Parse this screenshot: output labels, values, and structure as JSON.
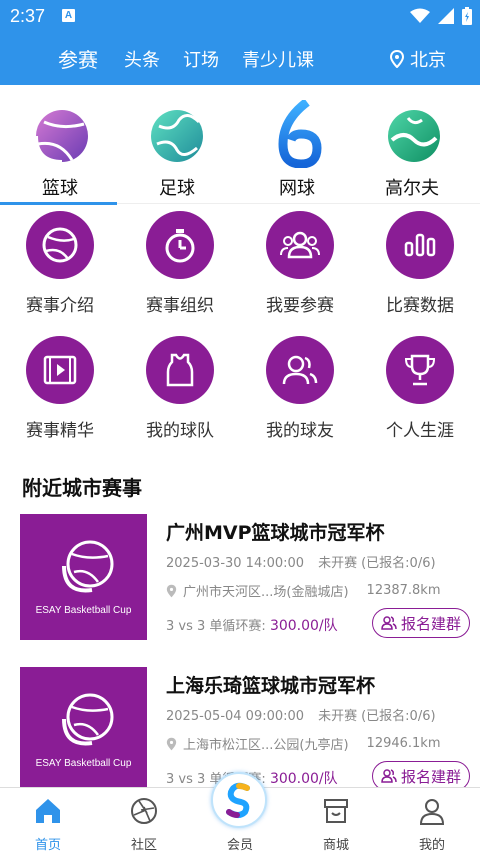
{
  "status": {
    "time": "2:37",
    "a_icon": "A"
  },
  "nav": {
    "tabs": [
      "参赛",
      "头条",
      "订场",
      "青少儿课"
    ],
    "location": "北京"
  },
  "sports": [
    "篮球",
    "足球",
    "网球",
    "高尔夫"
  ],
  "functions": [
    {
      "label": "赛事介绍",
      "icon": "basketball-icon"
    },
    {
      "label": "赛事组织",
      "icon": "stopwatch-icon"
    },
    {
      "label": "我要参赛",
      "icon": "group-icon"
    },
    {
      "label": "比赛数据",
      "icon": "bar-chart-icon"
    },
    {
      "label": "赛事精华",
      "icon": "video-icon"
    },
    {
      "label": "我的球队",
      "icon": "jersey-icon"
    },
    {
      "label": "我的球友",
      "icon": "friends-icon"
    },
    {
      "label": "个人生涯",
      "icon": "trophy-icon"
    }
  ],
  "section": {
    "title": "附近城市赛事"
  },
  "events": [
    {
      "title": "广州MVP篮球城市冠军杯",
      "date": "2025-03-30 14:00:00",
      "status": "未开赛",
      "signup": "(已报名:0/6)",
      "address": "广州市天河区...场(金融城店)",
      "distance": "12387.8km",
      "format": "3 vs 3  单循环赛:",
      "price": "300.00/队",
      "join_label": "报名建群",
      "brand": "ESAY Basketball Cup"
    },
    {
      "title": "上海乐琦篮球城市冠军杯",
      "date": "2025-05-04 09:00:00",
      "status": "未开赛",
      "signup": "(已报名:0/6)",
      "address": "上海市松江区...公园(九亭店)",
      "distance": "12946.1km",
      "format": "3 vs 3  单循环赛:",
      "price": "300.00/队",
      "join_label": "报名建群",
      "brand": "ESAY Basketball Cup"
    }
  ],
  "bottom_nav": [
    "首页",
    "社区",
    "会员",
    "商城",
    "我的"
  ],
  "colors": {
    "primary": "#2f93ea",
    "purple": "#8a1d95"
  }
}
